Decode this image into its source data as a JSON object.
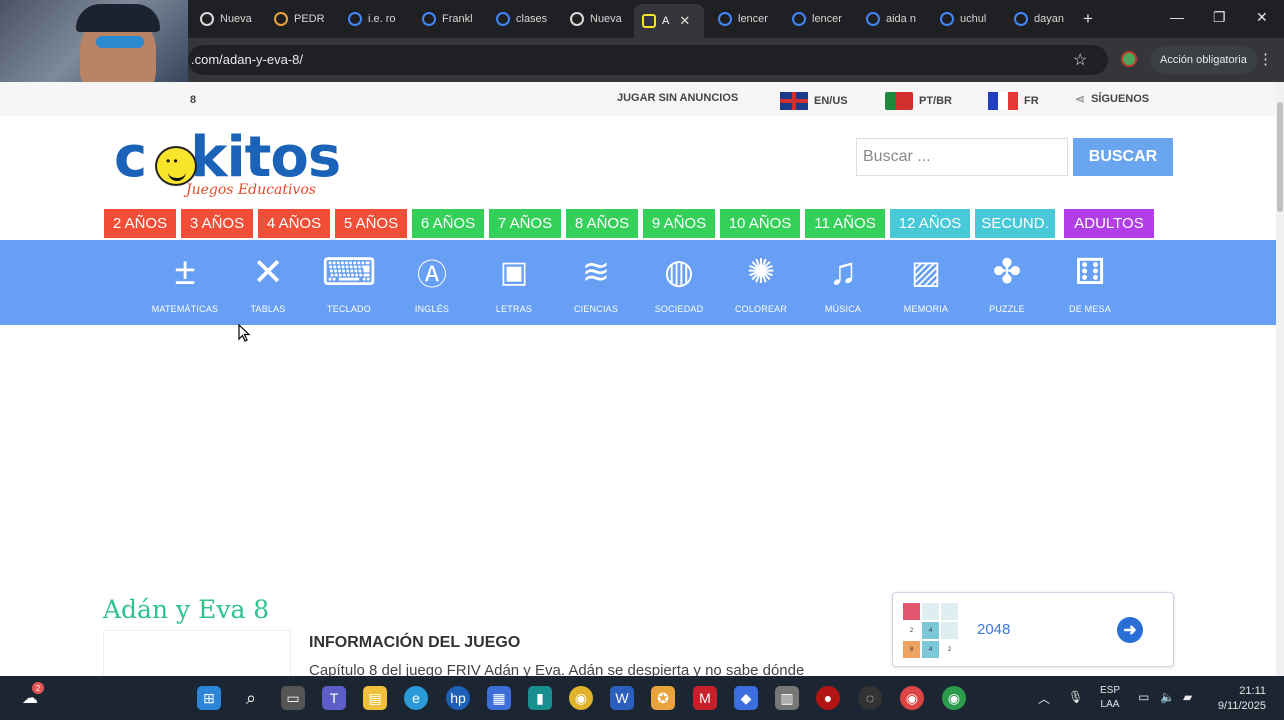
{
  "browser": {
    "tabs": [
      {
        "label": "Nueva",
        "active": false
      },
      {
        "label": "PEDR",
        "active": false
      },
      {
        "label": "i.e. ro",
        "active": false
      },
      {
        "label": "Frankl",
        "active": false
      },
      {
        "label": "clases",
        "active": false
      },
      {
        "label": "Nueva",
        "active": false
      },
      {
        "label": "A",
        "active": true
      },
      {
        "label": "lencer",
        "active": false
      },
      {
        "label": "lencer",
        "active": false
      },
      {
        "label": "aida n",
        "active": false
      },
      {
        "label": "uchul",
        "active": false
      },
      {
        "label": "dayan",
        "active": false
      }
    ],
    "url": ".com/adan-y-eva-8/",
    "action_button": "Acción obligatoria"
  },
  "topnav": {
    "cut_text": "8",
    "play_no_ads": "JUGAR SIN ANUNCIOS",
    "lang_en": "EN/US",
    "lang_pt": "PT/BR",
    "lang_fr": "FR",
    "follow": "SÍGUENOS"
  },
  "logo": {
    "text": "cokitos",
    "subtitle": "Juegos Educativos"
  },
  "search": {
    "placeholder": "Buscar ...",
    "button": "BUSCAR"
  },
  "age_groups": [
    {
      "label": "2 AÑOS",
      "color": "#f04e37"
    },
    {
      "label": "3 AÑOS",
      "color": "#f04e37"
    },
    {
      "label": "4 AÑOS",
      "color": "#f04e37"
    },
    {
      "label": "5 AÑOS",
      "color": "#f04e37"
    },
    {
      "label": "6 AÑOS",
      "color": "#35d05a"
    },
    {
      "label": "7 AÑOS",
      "color": "#35d05a"
    },
    {
      "label": "8 AÑOS",
      "color": "#35d05a"
    },
    {
      "label": "9 AÑOS",
      "color": "#35d05a"
    },
    {
      "label": "10 AÑOS",
      "color": "#35d05a"
    },
    {
      "label": "11 AÑOS",
      "color": "#35d05a"
    },
    {
      "label": "12 AÑOS",
      "color": "#48c9d8"
    },
    {
      "label": "SECUND.",
      "color": "#48c9d8"
    },
    {
      "label": "ADULTOS",
      "color": "#b13ee6"
    }
  ],
  "categories": [
    {
      "label": "MATEMÁTICAS",
      "icon": "math-icon"
    },
    {
      "label": "TABLAS",
      "icon": "times-table-icon"
    },
    {
      "label": "TECLADO",
      "icon": "keyboard-icon"
    },
    {
      "label": "INGLÉS",
      "icon": "english-icon"
    },
    {
      "label": "LETRAS",
      "icon": "letter-blocks-icon"
    },
    {
      "label": "CIENCIAS",
      "icon": "dna-icon"
    },
    {
      "label": "SOCIEDAD",
      "icon": "globe-pin-icon"
    },
    {
      "label": "COLOREAR",
      "icon": "paint-splash-icon"
    },
    {
      "label": "MÚSICA",
      "icon": "music-note-icon"
    },
    {
      "label": "MEMORIA",
      "icon": "picture-icon"
    },
    {
      "label": "PUZZLE",
      "icon": "puzzle-icon"
    },
    {
      "label": "DE MESA",
      "icon": "dice-icon"
    }
  ],
  "game": {
    "title": "Adán y Eva 8",
    "info_heading": "INFORMACIÓN DEL JUEGO",
    "info_text": "Capítulo 8 del juego FRIV Adán y Eva. Adán se despierta y no sabe dónde"
  },
  "related": {
    "title": "2048"
  },
  "taskbar": {
    "badge": "2",
    "lang_line1": "ESP",
    "lang_line2": "LAA",
    "time": "21:11",
    "date": "9/11/2025"
  }
}
